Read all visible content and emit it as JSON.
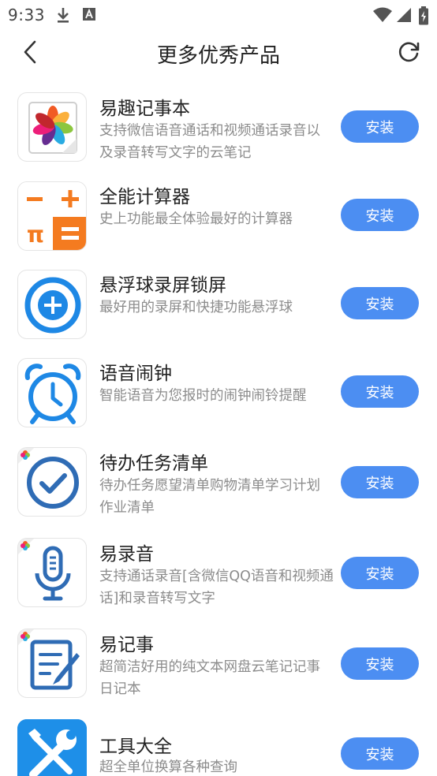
{
  "status_bar": {
    "time": "9:33"
  },
  "header": {
    "title": "更多优秀产品"
  },
  "apps": [
    {
      "name": "易趣记事本",
      "desc": "支持微信语音通话和视频通话录音以及录音转写文字的云笔记",
      "install_label": "安装"
    },
    {
      "name": "全能计算器",
      "desc": "史上功能最全体验最好的计算器",
      "install_label": "安装"
    },
    {
      "name": "悬浮球录屏锁屏",
      "desc": "最好用的录屏和快捷功能悬浮球",
      "install_label": "安装"
    },
    {
      "name": "语音闹钟",
      "desc": "智能语音为您报时的闹钟闹铃提醒",
      "install_label": "安装"
    },
    {
      "name": "待办任务清单",
      "desc": "待办任务愿望清单购物清单学习计划作业清单",
      "install_label": "安装"
    },
    {
      "name": "易录音",
      "desc": "支持通话录音[含微信QQ语音和视频通话]和录音转写文字",
      "install_label": "安装"
    },
    {
      "name": "易记事",
      "desc": "超简洁好用的纯文本网盘云笔记记事日记本",
      "install_label": "安装"
    },
    {
      "name": "工具大全",
      "desc": "超全单位换算各种查询",
      "install_label": "安装"
    }
  ],
  "calc_icon": {
    "minus": "−",
    "plus": "+",
    "pi": "π",
    "equals": "="
  },
  "colors": {
    "accent": "#4c8ef2",
    "text": "#222222",
    "desc": "#8c8c8c",
    "icon_blue": "#1e88e5"
  }
}
